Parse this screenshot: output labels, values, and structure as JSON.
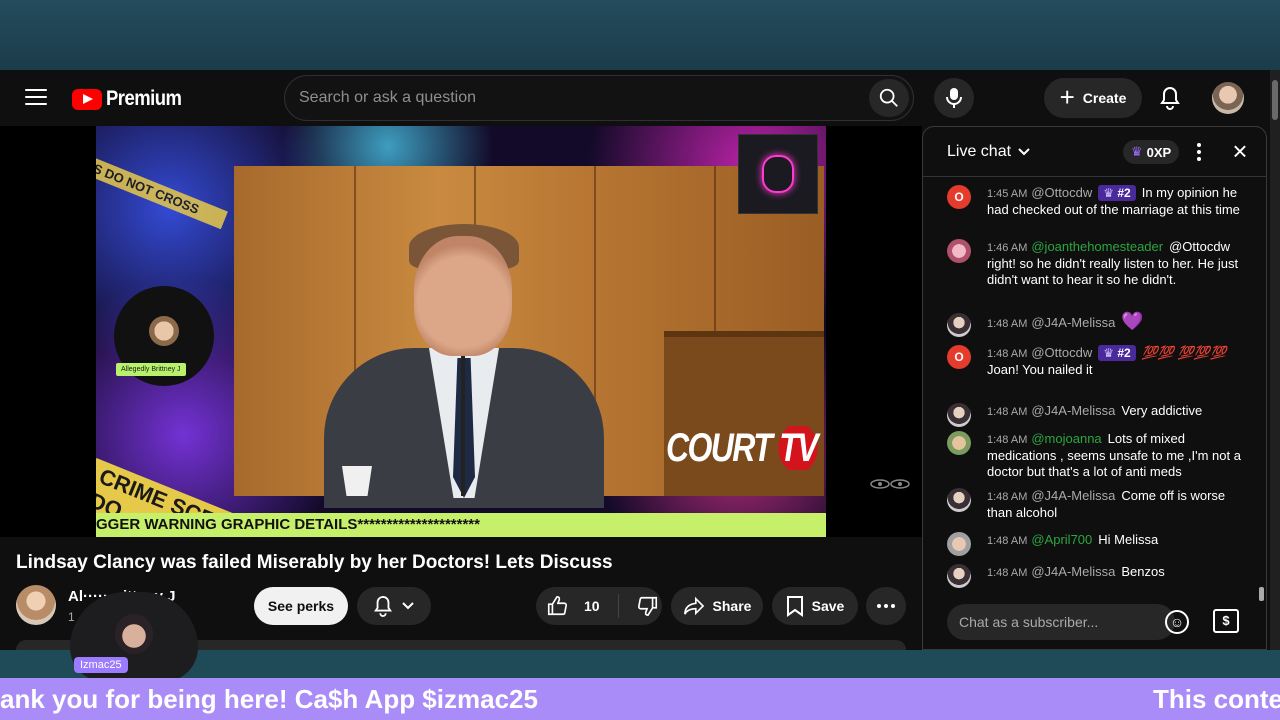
{
  "header": {
    "brand": "Premium",
    "search_placeholder": "Search or ask a question",
    "create_label": "Create"
  },
  "video": {
    "overlay_guest_label": "Allegedly Brittney J",
    "ticker_text": "GGER WARNING GRAPHIC DETAILS*********************",
    "network_logo_main": "COURT",
    "network_logo_tv": "TV",
    "tape_top": "US DO NOT CROSS",
    "tape_bottom": "CRIME SCENE DO",
    "title": "Lindsay Clancy was failed Miserably by her Doctors! Lets Discuss",
    "owner_name": "Al········ittney J",
    "owner_sub": "1"
  },
  "actions": {
    "perks": "See perks",
    "likes": "10",
    "share": "Share",
    "save": "Save"
  },
  "chat": {
    "title": "Live chat",
    "xp": "0XP",
    "input_placeholder": "Chat as a subscriber...",
    "messages": [
      {
        "av": "O",
        "time": "1:45 AM",
        "author": "@Ottocdw",
        "rank": "#2",
        "text": "In my opinion he had checked out of the marriage at this time"
      },
      {
        "av": "",
        "time": "1:46 AM",
        "author": "@joanthehomesteader",
        "rank": "",
        "text": "@Ottocdw right! so he didn't really listen to her. He just didn't want to hear it so he didn't."
      },
      {
        "av": "",
        "time": "1:48 AM",
        "author": "@J4A-Melissa",
        "rank": "",
        "text": "💜"
      },
      {
        "av": "O",
        "time": "1:48 AM",
        "author": "@Ottocdw",
        "rank": "#2",
        "emo": "💯💯 💯💯💯",
        "text": "Joan! You nailed it"
      },
      {
        "av": "",
        "time": "1:48 AM",
        "author": "@J4A-Melissa",
        "rank": "",
        "text": "Very addictive"
      },
      {
        "av": "",
        "time": "1:48 AM",
        "author": "@mojoanna",
        "rank": "",
        "text": "Lots of mixed medications , seems unsafe to me ,I'm not a doctor but that's a lot of anti meds"
      },
      {
        "av": "",
        "time": "1:48 AM",
        "author": "@J4A-Melissa",
        "rank": "",
        "text": "Come off is worse than alcohol"
      },
      {
        "av": "",
        "time": "1:48 AM",
        "author": "@April700",
        "rank": "",
        "text": "Hi Melissa"
      },
      {
        "av": "",
        "time": "1:48 AM",
        "author": "@J4A-Melissa",
        "rank": "",
        "text": "Benzos"
      }
    ]
  },
  "stream_overlay": {
    "cam_label": "Izmac25",
    "marquee_left": "ank you for being here! Ca$h App $izmac25",
    "marquee_right": "This conter"
  },
  "colors": {
    "brand_red": "#ff0000",
    "page_bg": "#0f0f0f",
    "marquee_bg": "#a98cf7",
    "ticker_bg": "#c7f06a",
    "mention_green": "#2ba640"
  },
  "icons": [
    "menu-icon",
    "youtube-logo-icon",
    "search-icon",
    "mic-icon",
    "plus-icon",
    "bell-icon",
    "chevron-down-icon",
    "crown-icon",
    "kebab-icon",
    "close-icon",
    "thumbs-up-icon",
    "thumbs-down-icon",
    "share-icon",
    "bookmark-icon",
    "more-icon",
    "emoji-icon",
    "super-chat-icon"
  ]
}
